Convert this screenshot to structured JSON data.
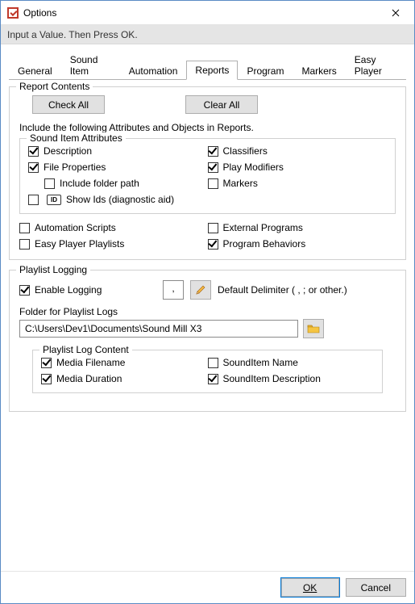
{
  "window": {
    "title": "Options"
  },
  "infobar": {
    "text": "Input a Value. Then Press OK."
  },
  "tabs": {
    "items": [
      "General",
      "Sound Item",
      "Automation",
      "Reports",
      "Program",
      "Markers",
      "Easy Player"
    ],
    "active_index": 3
  },
  "report_contents": {
    "legend": "Report Contents",
    "check_all": "Check All",
    "clear_all": "Clear All",
    "include_text": "Include the following Attributes and Objects in Reports.",
    "sound_item_attrs": {
      "legend": "Sound Item Attributes",
      "description": "Description",
      "file_properties": "File Properties",
      "include_folder_path": "Include folder path",
      "show_ids": "Show Ids (diagnostic aid)",
      "classifiers": "Classifiers",
      "play_modifiers": "Play Modifiers",
      "markers": "Markers",
      "id_badge": "ID"
    },
    "automation_scripts": "Automation Scripts",
    "easy_player_playlists": "Easy Player Playlists",
    "external_programs": "External Programs",
    "program_behaviors": "Program Behaviors"
  },
  "playlist_logging": {
    "legend": "Playlist Logging",
    "enable_logging": "Enable Logging",
    "delimiter_value": ",",
    "default_delimiter_label": "Default Delimiter ( , ; or other.)",
    "folder_label": "Folder for Playlist Logs",
    "folder_path": "C:\\Users\\Dev1\\Documents\\Sound Mill X3",
    "log_content": {
      "legend": "Playlist Log Content",
      "media_filename": "Media Filename",
      "media_duration": "Media Duration",
      "sounditem_name": "SoundItem Name",
      "sounditem_description": "SoundItem Description"
    }
  },
  "buttons": {
    "ok": "OK",
    "cancel": "Cancel"
  }
}
